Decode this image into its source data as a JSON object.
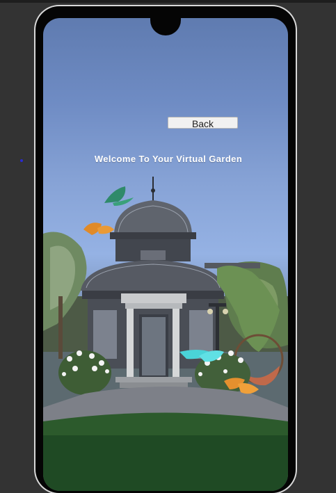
{
  "window": {
    "background": "#333333",
    "frame_color": "#050505"
  },
  "screen": {
    "back_button_label": "Back",
    "welcome_text": "Welcome To Your Virtual Garden"
  },
  "scene": {
    "icons": [
      "gazebo-icon",
      "tree-icon",
      "butterfly-icon",
      "hammock-icon",
      "flower-bush-icon",
      "lamp-post-icon",
      "grass-icon"
    ],
    "colors": {
      "sky_top": "#5f7bb0",
      "sky_bottom": "#95b2e4",
      "grass": "#1f4a24",
      "gazebo_glass": "#5c5f66"
    }
  }
}
